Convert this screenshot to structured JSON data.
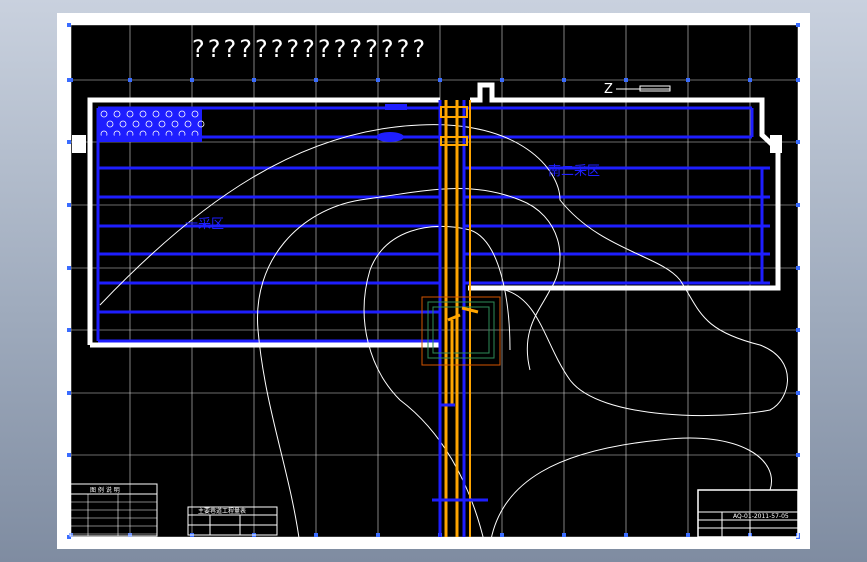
{
  "drawing": {
    "title": "???????????????",
    "north_label": "Z",
    "zone_left_label": "一采区",
    "zone_right_label": "南二采区",
    "title_block_code": "AQ-01-2011-57-05"
  },
  "legend_left": {
    "title": "图 例 说 明",
    "rows": 5
  },
  "legend_mid": {
    "title": "主要巷道工程量表"
  },
  "colors": {
    "background": "#000000",
    "grid": "#ffffff",
    "roadway": "#1e1eff",
    "shaft": "#ffa500",
    "contour": "#ffffff",
    "outline": "#ffffff"
  }
}
